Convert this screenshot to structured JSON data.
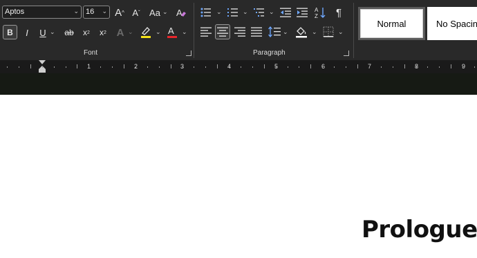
{
  "font": {
    "family_value": "Aptos",
    "size_value": "16",
    "group_label": "Font",
    "grow_glyph": "A",
    "shrink_glyph": "A",
    "case_glyph": "Aa",
    "bold_glyph": "B",
    "italic_glyph": "I",
    "underline_glyph": "U",
    "strike_glyph": "ab",
    "subscript_glyph": "x",
    "superscript_glyph": "x",
    "effects_glyph": "A",
    "font_color_glyph": "A",
    "highlight_color": "#f5e21a",
    "font_color": "#e8262b"
  },
  "paragraph": {
    "group_label": "Paragraph",
    "pilcrow_glyph": "¶"
  },
  "styles": {
    "items": [
      "Normal",
      "No Spacin"
    ]
  },
  "ruler": {
    "numbers": [
      "1",
      "2",
      "3",
      "4",
      "5",
      "6",
      "7",
      "8",
      "9"
    ]
  },
  "document": {
    "heading": "Prologue"
  }
}
